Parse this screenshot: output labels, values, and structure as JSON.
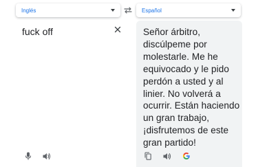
{
  "source_language": {
    "label": "Inglés"
  },
  "target_language": {
    "label": "Español"
  },
  "source": {
    "text": "fuck off"
  },
  "target": {
    "text": "Señor árbitro, discúlpeme por molestarle. Me he equivocado y le pido perdón a usted y al linier. No volverá a ocurrir. Están haciendo un gran trabajo, ¡disfrutemos de este gran partido!"
  },
  "icons": {
    "source_dropdown": "chevron-down-icon",
    "target_dropdown": "chevron-down-icon",
    "swap": "swap-languages-icon",
    "clear": "close-icon",
    "microphone": "microphone-icon",
    "source_listen": "speaker-icon",
    "copy": "copy-icon",
    "target_listen": "speaker-icon",
    "google": "google-logo-icon"
  },
  "colors": {
    "accent": "#1a73e8",
    "text": "#202124",
    "icon": "#5f6368",
    "target_background": "#f1f3f4"
  }
}
